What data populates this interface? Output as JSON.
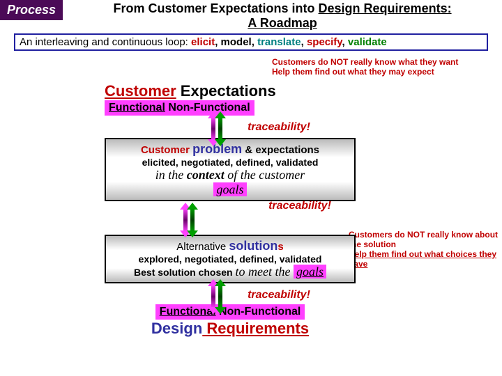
{
  "header": {
    "badge": "Process",
    "title_a": "From Customer Expectations into ",
    "title_b": "Design Requirements:",
    "title_c": "A Roadmap"
  },
  "loop": {
    "pre": "An interleaving and continuous loop: ",
    "w1": "elicit",
    "s1": ", ",
    "w2": "model",
    "s2": ", ",
    "w3": "translate",
    "s3": ", ",
    "w4": "specify",
    "s4": ", ",
    "w5": "validate"
  },
  "notes": {
    "top1": "Customers do NOT really know what they want",
    "top2": "Help them find out what they may expect",
    "mid1": "Customers do NOT really know about the solution",
    "mid2": "Help them find out what choices they have"
  },
  "ce": {
    "cust": "Customer",
    "exp": " Expectations",
    "fn": "Functional",
    "nfn": " Non-Functional"
  },
  "trace": "traceability!",
  "box1": {
    "l1a": "Customer ",
    "l1b": "problem",
    "l1c": " & expectations",
    "l2": "elicited, negotiated, defined, validated",
    "l3a": "in the ",
    "l3b": "context",
    "l3c": "  of the customer",
    "l4": "goals"
  },
  "box2": {
    "l1a": "Alternative ",
    "l1b": "solution",
    "l1c": "s",
    "l2": "explored, negotiated, defined, validated",
    "l3a": "Best solution chosen ",
    "l3b": "to meet the ",
    "l3c": "goals"
  },
  "dr": {
    "d1": "Design",
    "d2": " Requirements"
  }
}
